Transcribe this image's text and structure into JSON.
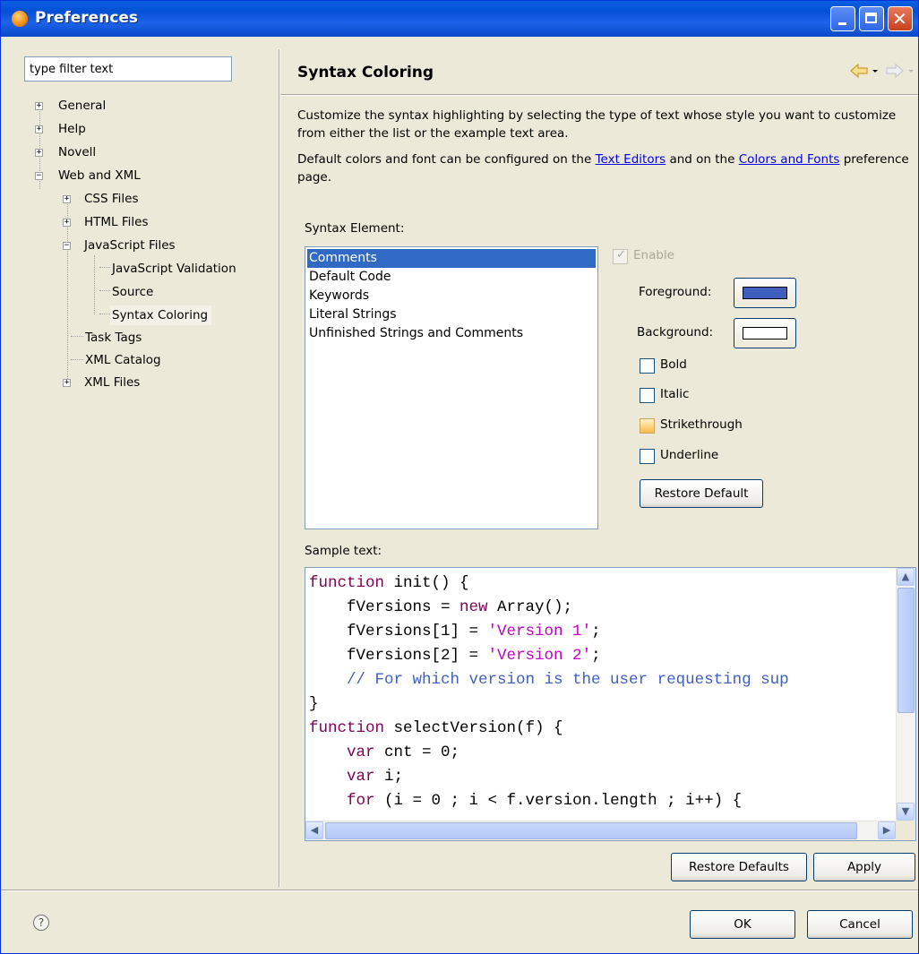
{
  "window": {
    "title": "Preferences"
  },
  "filter": {
    "placeholder": "type filter text",
    "value": "type filter text"
  },
  "tree": {
    "general": "General",
    "help": "Help",
    "novell": "Novell",
    "web_and_xml": "Web and XML",
    "css_files": "CSS Files",
    "html_files": "HTML Files",
    "javascript_files": "JavaScript Files",
    "javascript_validation": "JavaScript Validation",
    "source": "Source",
    "syntax_coloring": "Syntax Coloring",
    "task_tags": "Task Tags",
    "xml_catalog": "XML Catalog",
    "xml_files": "XML Files",
    "selected": "Syntax Coloring"
  },
  "page": {
    "title": "Syntax Coloring",
    "description1": "Customize the syntax highlighting by selecting the type of text whose style you want to customize from either the list or the example text area.",
    "description2_before": "Default colors and font can be configured on the ",
    "link_text_editors": "Text Editors",
    "description2_middle": " and on the ",
    "link_colors_fonts": "Colors and Fonts",
    "description2_after": " preference page."
  },
  "syntax": {
    "label": "Syntax Element:",
    "items": [
      "Comments",
      "Default Code",
      "Keywords",
      "Literal Strings",
      "Unfinished Strings and Comments"
    ],
    "selected": "Comments"
  },
  "style": {
    "enable_label": "Enable",
    "enable_checked": true,
    "foreground_label": "Foreground:",
    "foreground_color": "#3f5fbf",
    "background_label": "Background:",
    "background_color": "#ffffff",
    "bold_label": "Bold",
    "bold_checked": false,
    "italic_label": "Italic",
    "italic_checked": false,
    "strikethrough_label": "Strikethrough",
    "strikethrough_checked": false,
    "underline_label": "Underline",
    "underline_checked": false,
    "restore_default_label": "Restore Default"
  },
  "sample": {
    "label": "Sample text:",
    "colors": {
      "keyword": "#7f0055",
      "string": "#c000c0",
      "comment": "#3f5fbf",
      "default": "#000000"
    },
    "lines": [
      [
        {
          "t": "kw",
          "s": "function"
        },
        {
          "t": "d",
          "s": " init() {"
        }
      ],
      [
        {
          "t": "d",
          "s": "    fVersions = "
        },
        {
          "t": "kw",
          "s": "new"
        },
        {
          "t": "d",
          "s": " Array();"
        }
      ],
      [
        {
          "t": "d",
          "s": "    fVersions[1] = "
        },
        {
          "t": "str",
          "s": "'Version 1'"
        },
        {
          "t": "d",
          "s": ";"
        }
      ],
      [
        {
          "t": "d",
          "s": "    fVersions[2] = "
        },
        {
          "t": "str",
          "s": "'Version 2'"
        },
        {
          "t": "d",
          "s": ";"
        }
      ],
      [
        {
          "t": "cm",
          "s": "    // For which version is the user requesting sup"
        }
      ],
      [
        {
          "t": "d",
          "s": "}"
        }
      ],
      [
        {
          "t": "kw",
          "s": "function"
        },
        {
          "t": "d",
          "s": " selectVersion(f) {"
        }
      ],
      [
        {
          "t": "d",
          "s": "    "
        },
        {
          "t": "kw",
          "s": "var"
        },
        {
          "t": "d",
          "s": " cnt = 0;"
        }
      ],
      [
        {
          "t": "d",
          "s": "    "
        },
        {
          "t": "kw",
          "s": "var"
        },
        {
          "t": "d",
          "s": " i;"
        }
      ],
      [
        {
          "t": "d",
          "s": "    "
        },
        {
          "t": "kw",
          "s": "for"
        },
        {
          "t": "d",
          "s": " (i = 0 ; i < f.version.length ; i++) {"
        }
      ]
    ]
  },
  "buttons": {
    "restore_defaults": "Restore Defaults",
    "apply": "Apply",
    "ok": "OK",
    "cancel": "Cancel",
    "help_icon": "help-icon"
  }
}
